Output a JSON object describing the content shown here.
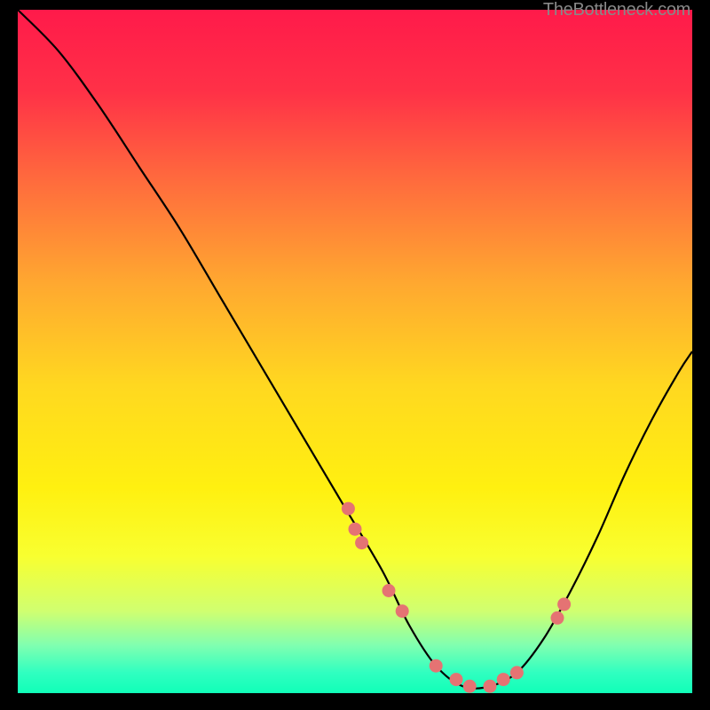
{
  "watermark": "TheBottleneck.com",
  "chart_data": {
    "type": "line",
    "title": "",
    "xlabel": "",
    "ylabel": "",
    "xlim": [
      0,
      100
    ],
    "ylim": [
      0,
      100
    ],
    "background_gradient": {
      "stops": [
        {
          "offset": 0.0,
          "color": "#ff1a4a"
        },
        {
          "offset": 0.12,
          "color": "#ff3147"
        },
        {
          "offset": 0.25,
          "color": "#ff6b3d"
        },
        {
          "offset": 0.4,
          "color": "#ffa830"
        },
        {
          "offset": 0.55,
          "color": "#ffd820"
        },
        {
          "offset": 0.7,
          "color": "#fff010"
        },
        {
          "offset": 0.8,
          "color": "#f8ff30"
        },
        {
          "offset": 0.88,
          "color": "#d0ff70"
        },
        {
          "offset": 0.93,
          "color": "#80ffb0"
        },
        {
          "offset": 0.97,
          "color": "#30ffc0"
        },
        {
          "offset": 1.0,
          "color": "#10ffb8"
        }
      ]
    },
    "series": [
      {
        "name": "bottleneck-curve",
        "type": "line",
        "color": "#000000",
        "x": [
          0,
          6,
          12,
          18,
          24,
          30,
          36,
          42,
          48,
          54,
          58,
          62,
          66,
          70,
          74,
          78,
          82,
          86,
          90,
          94,
          98,
          100
        ],
        "y": [
          100,
          94,
          86,
          77,
          68,
          58,
          48,
          38,
          28,
          18,
          10,
          4,
          1,
          1,
          3,
          8,
          15,
          23,
          32,
          40,
          47,
          50
        ]
      },
      {
        "name": "data-points",
        "type": "scatter",
        "color": "#e57373",
        "x": [
          49,
          50,
          51,
          55,
          57,
          62,
          65,
          67,
          70,
          72,
          74,
          80,
          81
        ],
        "y": [
          27,
          24,
          22,
          15,
          12,
          4,
          2,
          1,
          1,
          2,
          3,
          11,
          13
        ]
      }
    ]
  }
}
